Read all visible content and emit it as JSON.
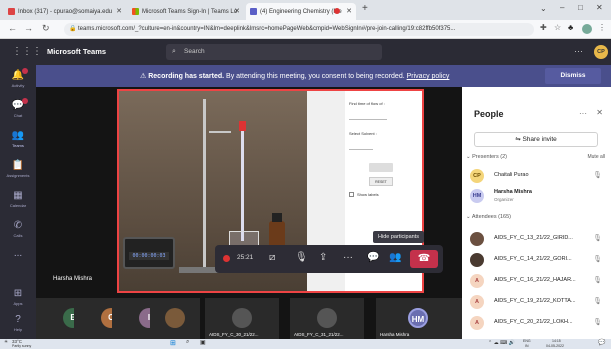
{
  "browser": {
    "tabs": [
      {
        "label": "Inbox (317) - cpurao@somaiya.edu"
      },
      {
        "label": "Microsoft Teams Sign-In | Teams Lo"
      },
      {
        "label": "(4) Engineering Chemistry (Me"
      }
    ],
    "new_tab": "+",
    "url": "teams.microsoft.com/_?culture=en-in&country=IN&lm=deeplink&lmsrc=homePageWeb&cmpid=WebSignIn#/pre-join-calling/19:c82ffb50f375..."
  },
  "teams": {
    "app_name": "Microsoft Teams",
    "search_placeholder": "Search",
    "user_initials": "CP"
  },
  "rail": {
    "items": [
      {
        "label": "Activity",
        "icon": "bell-icon"
      },
      {
        "label": "Chat",
        "icon": "chat-icon"
      },
      {
        "label": "Teams",
        "icon": "teams-icon"
      },
      {
        "label": "Assignments",
        "icon": "assignments-icon"
      },
      {
        "label": "Calendar",
        "icon": "calendar-icon"
      },
      {
        "label": "Calls",
        "icon": "phone-icon"
      },
      {
        "label": "...",
        "icon": "more-icon"
      },
      {
        "label": "Apps",
        "icon": "apps-icon"
      },
      {
        "label": "Help",
        "icon": "help-icon"
      }
    ]
  },
  "banner": {
    "bold": "Recording has started.",
    "text": "By attending this meeting, you consent to being recorded.",
    "link": "Privacy policy",
    "dismiss": "Dismiss"
  },
  "lab": {
    "fields": [
      "Find time of flow of :",
      "Select Solvent :",
      "Show labels"
    ],
    "timer": "00:00:00:03",
    "buttons": [
      "RESET"
    ]
  },
  "meeting": {
    "presenter_name": "Harsha Mishra",
    "timer": "25:21",
    "tooltip": "Hide participants"
  },
  "gallery": [
    {
      "initial": "E",
      "color": "#3a6b4a"
    },
    {
      "initial": "C",
      "color": "#b07040"
    },
    {
      "initial": "I",
      "color": "#8a6b8a"
    },
    {
      "initial": "",
      "color": "#7a5a3a"
    },
    {
      "initial": "",
      "color": "#555555",
      "name": "AIDS_FY_C_30_21/22..."
    },
    {
      "initial": "",
      "color": "#555555",
      "name": "AIDS_FY_C_31_21/22..."
    },
    {
      "initial": "HM",
      "color": "#6a6eb0",
      "name": "Harsha Mishra"
    }
  ],
  "people": {
    "title": "People",
    "share_invite": "Share invite",
    "presenters_header": "Presenters (2)",
    "mute_all": "Mute all",
    "presenters": [
      {
        "initials": "CP",
        "name": "Chaitali Purao",
        "color": "#f4d57a",
        "role": ""
      },
      {
        "initials": "HM",
        "name": "Harsha Mishra",
        "color": "#c9cbf0",
        "role": "Organizer"
      }
    ],
    "attendees_header": "Attendees (165)",
    "attendees": [
      {
        "initials": "",
        "name": "AIDS_FY_C_13_21/22_GIRID..."
      },
      {
        "initials": "",
        "name": "AIDS_FY_C_14_21/22_GORI..."
      },
      {
        "initials": "A",
        "name": "AIDS_FY_C_16_21/22_HAJAR..."
      },
      {
        "initials": "A",
        "name": "AIDS_FY_C_19_21/22_KOTTA..."
      },
      {
        "initials": "A",
        "name": "AIDS_FY_C_20_21/22_LOKH..."
      }
    ]
  },
  "taskbar": {
    "weather_temp": "33°C",
    "weather_text": "Partly sunny",
    "lang": "ENG",
    "region": "IN",
    "time": "14:15",
    "date": "04-05-2022"
  }
}
